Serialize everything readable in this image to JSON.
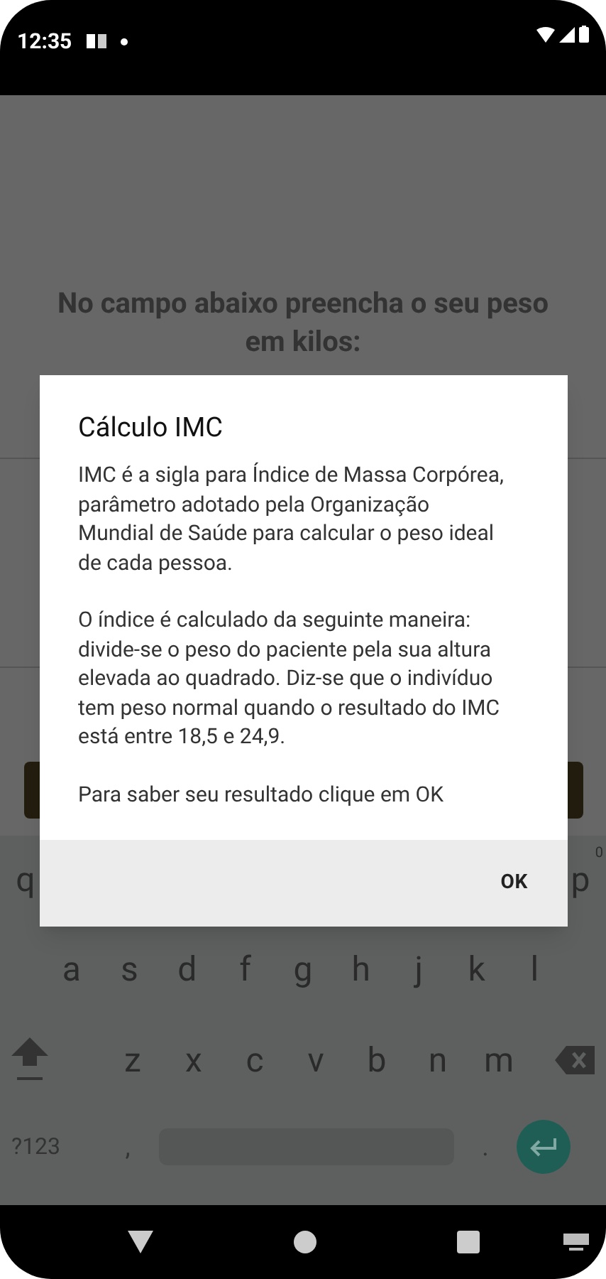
{
  "status_bar": {
    "time": "12:35"
  },
  "prompt": "No campo abaixo preencha o seu peso em kilos:",
  "dialog": {
    "title": "Cálculo IMC",
    "paragraphs": [
      "IMC é a sigla para Índice de Massa Corpórea, parâmetro adotado pela Organização Mundial de Saúde para calcular o peso ideal de cada pessoa.",
      "O índice é calculado da seguinte maneira: divide-se o peso do paciente pela sua altura elevada ao quadrado. Diz-se que o indivíduo tem peso normal quando o resultado do IMC está entre 18,5 e 24,9.",
      "Para saber seu resultado clique em OK"
    ],
    "button": "OK"
  },
  "keyboard": {
    "top_row": [
      {
        "label": "q"
      },
      {
        "label": "p",
        "hint": "0"
      }
    ],
    "middle_row": [
      "a",
      "s",
      "d",
      "f",
      "g",
      "h",
      "j",
      "k",
      "l"
    ],
    "bottom_row": [
      "z",
      "x",
      "c",
      "v",
      "b",
      "n",
      "m"
    ],
    "symbols_key": "?123",
    "comma_key": ",",
    "period_key": "."
  }
}
